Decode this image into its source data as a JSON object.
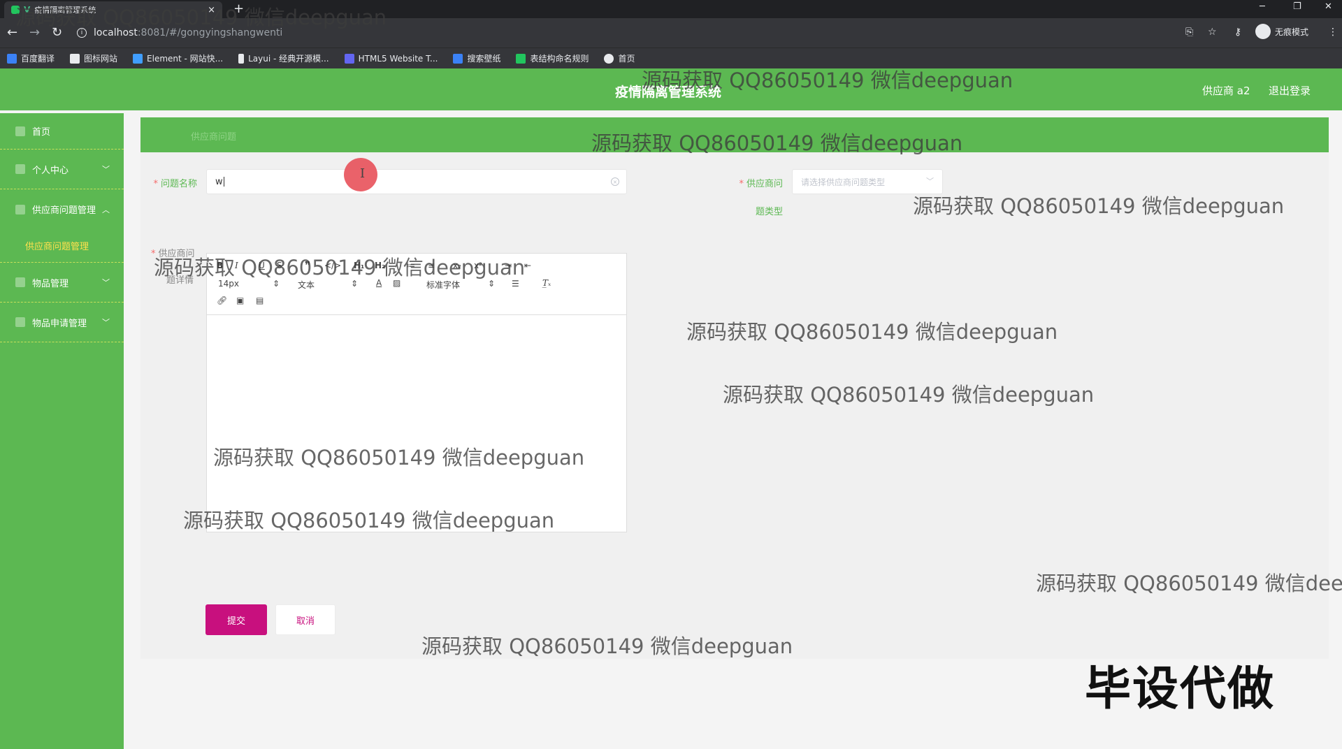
{
  "browser": {
    "tab_title": "疫情隔离管理系统",
    "tab_close": "×",
    "new_tab": "+",
    "url_host": "localhost",
    "url_path": ":8081/#/gongyingshangwenti",
    "incognito_label": "无痕模式",
    "bookmarks": [
      {
        "label": "百度翻译",
        "color": "#3b82f6"
      },
      {
        "label": "图标网站",
        "color": "#e8eaed"
      },
      {
        "label": "Element - 网站快...",
        "color": "#409eff"
      },
      {
        "label": "Layui - 经典开源模...",
        "color": "#e8eaed"
      },
      {
        "label": "HTML5 Website T...",
        "color": "#6366f1"
      },
      {
        "label": "搜索壁纸",
        "color": "#3b82f6"
      },
      {
        "label": "表结构命名规则",
        "color": "#22c55e"
      },
      {
        "label": "首页",
        "color": "#e8eaed"
      }
    ]
  },
  "header": {
    "title": "疫情隔离管理系统",
    "user": "供应商 a2",
    "logout": "退出登录"
  },
  "sidebar": {
    "items": [
      {
        "label": "首页",
        "chevron": ""
      },
      {
        "label": "个人中心",
        "chevron": "﹀"
      },
      {
        "label": "供应商问题管理",
        "chevron": "︿"
      },
      {
        "label": "供应商问题管理",
        "chevron": ""
      },
      {
        "label": "物品管理",
        "chevron": "﹀"
      },
      {
        "label": "物品申请管理",
        "chevron": "﹀"
      }
    ]
  },
  "main": {
    "band_label": "供应商问题",
    "form": {
      "name_label": "问题名称",
      "name_value": "w",
      "type_label_line1": "供应商问",
      "type_label_line2": "题类型",
      "type_placeholder": "请选择供应商问题类型",
      "detail_label_line1": "供应商问",
      "detail_label_line2": "题详情"
    },
    "editor": {
      "font_size": "14px",
      "text_type": "文本",
      "font_family": "标准字体"
    },
    "submit": "提交",
    "cancel": "取消"
  },
  "watermarks": [
    "源码获取 QQ86050149 微信deepguan",
    "源码获取 QQ86050149 微信deepguan",
    "源码获取 QQ86050149 微信deepguan",
    "源码获取 QQ86050149 微信deepguan",
    "源码获取 QQ86050149 微信deepguan",
    "源码获取 QQ86050149 微信deepguan",
    "源码获取 QQ86050149 微信deepguan",
    "源码获取 QQ86050149 微信deepguan",
    "源码获取 QQ86050149 微信deepguan",
    "源码获取 QQ86050149 微信dee",
    "源码获取 QQ86050149 微信deepguan"
  ],
  "overlay_text": "毕设代做"
}
